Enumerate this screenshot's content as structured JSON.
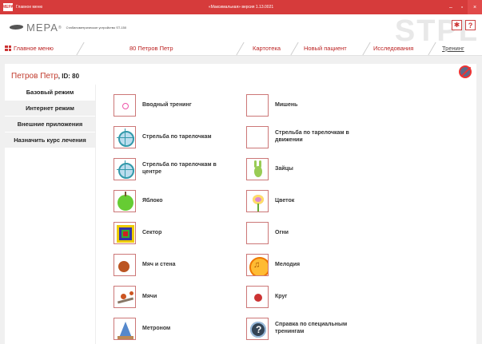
{
  "window": {
    "menu_name": "Главное меню",
    "title": "«Максимальная» версия 1.13.0021",
    "app_icon": "МЕРА",
    "controls": [
      "–",
      "▫",
      "×"
    ]
  },
  "brand": {
    "logo_text": "МЕРА",
    "reg": "®",
    "device": "Стабилометрическое устройство ST-150",
    "watermark": "STPL",
    "icons": [
      "✱",
      "?"
    ]
  },
  "nav": {
    "main_menu": "Главное меню",
    "patient": "80  Петров  Петр",
    "tabs": [
      "Картотека",
      "Новый пациент",
      "Исследования",
      "Тренинг"
    ],
    "active_tab": "Тренинг"
  },
  "patient": {
    "name": "Петров Петр",
    "id_label": ", ID: 80"
  },
  "sidebar": {
    "items": [
      "Базовый режим",
      "Интернет режим",
      "Внешние приложения",
      "Назначить курс лечения"
    ]
  },
  "exercises": {
    "left": [
      {
        "label": "Вводный тренинг",
        "icon": "grid-target-icon"
      },
      {
        "label": "Стрельба по тарелочкам",
        "icon": "crosshair-icon"
      },
      {
        "label": "Стрельба по тарелочкам в центре",
        "icon": "crosshair-center-icon"
      },
      {
        "label": "Яблоко",
        "icon": "apple-icon"
      },
      {
        "label": "Сектор",
        "icon": "sector-icon"
      },
      {
        "label": "Мяч и стена",
        "icon": "ball-wall-icon"
      },
      {
        "label": "Мячи",
        "icon": "balls-icon"
      },
      {
        "label": "Метроном",
        "icon": "metronome-icon"
      }
    ],
    "right": [
      {
        "label": "Мишень",
        "icon": "bullseye-icon"
      },
      {
        "label": "Стрельба по тарелочкам в движении",
        "icon": "moving-targets-icon"
      },
      {
        "label": "Зайцы",
        "icon": "bunny-icon"
      },
      {
        "label": "Цветок",
        "icon": "flower-icon"
      },
      {
        "label": "Огни",
        "icon": "lights-icon"
      },
      {
        "label": "Мелодия",
        "icon": "melody-icon"
      },
      {
        "label": "Круг",
        "icon": "circle-icon"
      },
      {
        "label": "Справка по специальным тренингам",
        "icon": "help-icon"
      }
    ]
  },
  "colors": {
    "titlebar": "#d63b3b",
    "accent": "#b22222"
  }
}
